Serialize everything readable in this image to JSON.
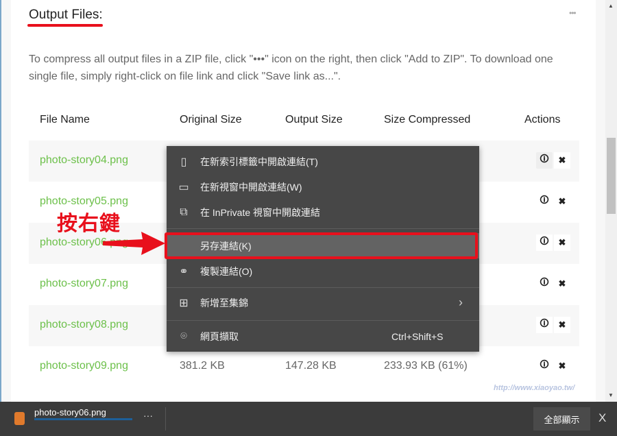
{
  "section": {
    "title": "Output Files:",
    "more": "•••",
    "description": "To compress all output files in a ZIP file, click \"•••\" icon on the right, then click \"Add to ZIP\". To download one single file, simply right-click on file link and click \"Save link as...\"."
  },
  "table": {
    "headers": [
      "File Name",
      "Original Size",
      "Output Size",
      "Size Compressed",
      "Actions"
    ],
    "rows": [
      {
        "name": "photo-story04.png",
        "orig": "",
        "out": "",
        "comp": ""
      },
      {
        "name": "photo-story05.png",
        "orig": "",
        "out": "",
        "comp": ""
      },
      {
        "name": "photo-story06.png",
        "orig": "",
        "out": "",
        "comp": ""
      },
      {
        "name": "photo-story07.png",
        "orig": "",
        "out": "",
        "comp": ""
      },
      {
        "name": "photo-story08.png",
        "orig": "",
        "out": "",
        "comp": ""
      },
      {
        "name": "photo-story09.png",
        "orig": "381.2 KB",
        "out": "147.28 KB",
        "comp": "233.93 KB (61%)"
      }
    ],
    "info_icon": "🛈",
    "delete_icon": "✖"
  },
  "context_menu": {
    "items": [
      {
        "label": "在新索引標籤中開啟連結(T)",
        "icon": "page-icon"
      },
      {
        "label": "在新視窗中開啟連結(W)",
        "icon": "window-icon"
      },
      {
        "label": "在 InPrivate 視窗中開啟連結",
        "icon": "inprivate-icon"
      },
      {
        "label": "另存連結(K)",
        "icon": ""
      },
      {
        "label": "複製連結(O)",
        "icon": "link-icon"
      },
      {
        "label": "新增至集錦",
        "icon": "collections-icon"
      },
      {
        "label": "網頁擷取",
        "icon": "capture-icon",
        "shortcut": "Ctrl+Shift+S"
      }
    ]
  },
  "annotation": {
    "text": "按右鍵",
    "color": "#e8101c"
  },
  "download_bar": {
    "filename": "photo-story06.png",
    "progress": 1.0,
    "more": "···",
    "show_all": "全部顯示",
    "close": "X"
  },
  "watermark": "http://www.xiaoyao.tw/"
}
